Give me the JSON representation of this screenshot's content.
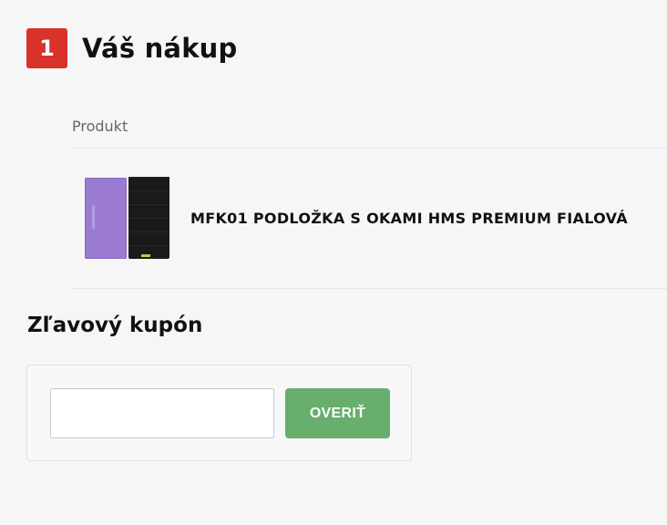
{
  "step": {
    "number": "1",
    "title": "Váš nákup",
    "badge_color": "#d8322a"
  },
  "cart": {
    "column_header": "Produkt",
    "items": [
      {
        "name": "MFK01 PODLOŽKA S OKAMI HMS PREMIUM FIALOVÁ",
        "image_icon": "product-thumbnail-purple-and-black-mats"
      }
    ]
  },
  "coupon": {
    "heading": "Zľavový kupón",
    "input_value": "",
    "placeholder": "",
    "button_label": "OVERIŤ",
    "button_color": "#68ae6c"
  }
}
